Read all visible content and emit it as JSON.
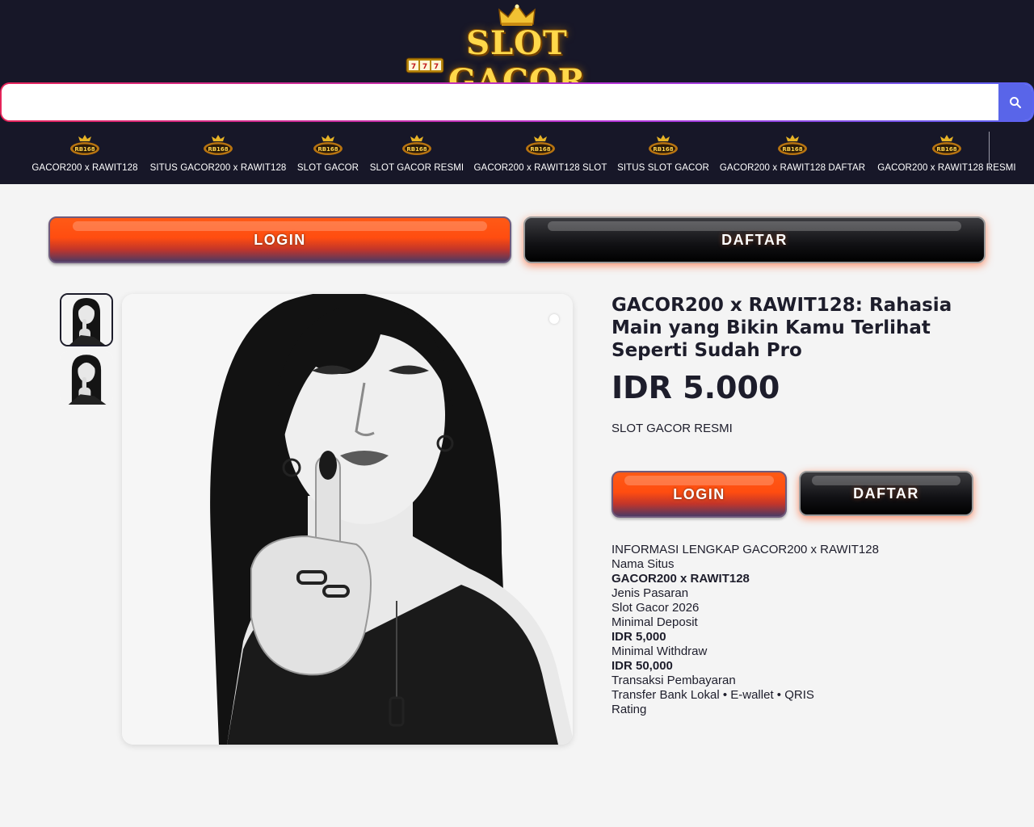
{
  "logo": {
    "text": "SLOT GACOR"
  },
  "search": {
    "placeholder": "",
    "value": ""
  },
  "nav": {
    "items": [
      {
        "label": "GACOR200 x RAWIT128"
      },
      {
        "label": "SITUS GACOR200 x RAWIT128"
      },
      {
        "label": "SLOT GACOR"
      },
      {
        "label": "SLOT GACOR RESMI"
      },
      {
        "label": "GACOR200 x RAWIT128 SLOT"
      },
      {
        "label": "SITUS SLOT GACOR"
      },
      {
        "label": "GACOR200 x RAWIT128 DAFTAR"
      },
      {
        "label": "GACOR200 x RAWIT128 RESMI"
      }
    ],
    "icon_badge": "RB168"
  },
  "cta": {
    "login_label": "LOGIN",
    "daftar_label": "DAFTAR"
  },
  "product": {
    "title": "GACOR200 x RAWIT128: Rahasia Main yang Bikin Kamu Terlihat Seperti Sudah Pro",
    "price": "IDR 5.000",
    "subtitle": "SLOT GACOR RESMI",
    "login_label": "LOGIN",
    "daftar_label": "DAFTAR"
  },
  "info": {
    "heading": "INFORMASI LENGKAP GACOR200 x RAWIT128",
    "site_name_label": "Nama Situs",
    "site_name_value": "GACOR200 x RAWIT128",
    "market_label": "Jenis Pasaran",
    "market_value": "Slot Gacor 2026",
    "min_deposit_label": "Minimal Deposit",
    "min_deposit_value": "IDR 5,000",
    "min_withdraw_label": "Minimal Withdraw",
    "min_withdraw_value": "IDR 50,000",
    "payment_label": "Transaksi Pembayaran",
    "payment_value": "Transfer Bank Lokal • E-wallet • QRIS",
    "rating_label": "Rating"
  },
  "colors": {
    "header_bg": "#171728",
    "page_bg": "#f4f4f4",
    "login_orange": "#ff4d10",
    "search_button": "#5965e9"
  }
}
